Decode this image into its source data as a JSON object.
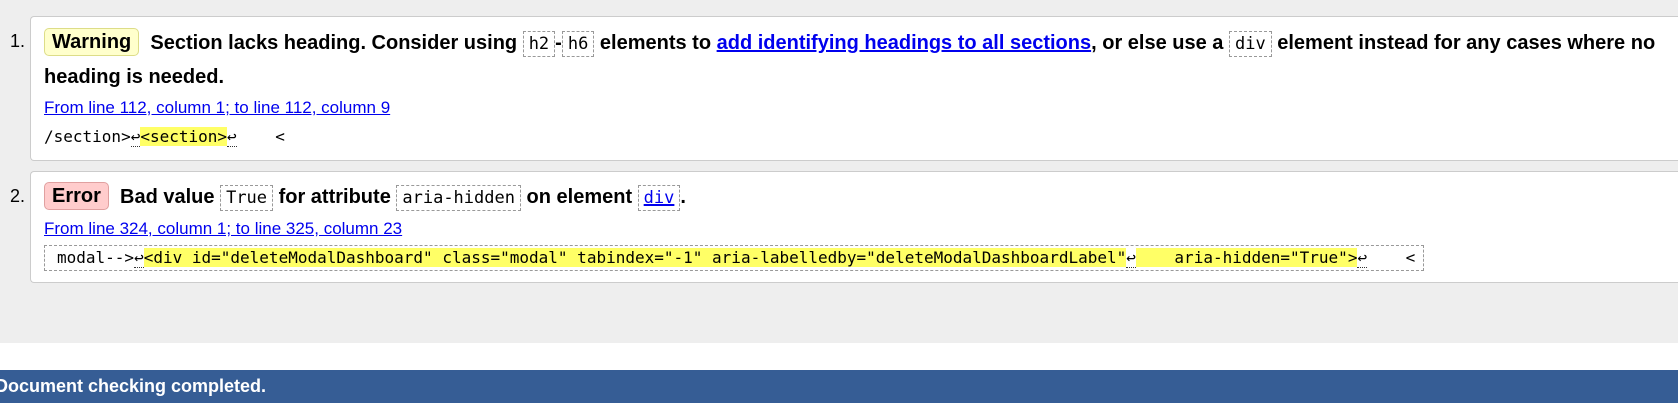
{
  "messages": [
    {
      "number": "1.",
      "type": "Warning",
      "text_1": "Section lacks heading. Consider using",
      "code_1": "h2",
      "dash": "-",
      "code_2": "h6",
      "text_2": "elements to",
      "link": "add identifying headings to all sections",
      "text_3": ", or else use a",
      "code_3": "div",
      "text_4": "element instead for any cases where no",
      "text_5": "heading is needed.",
      "location": "From line 112, column 1; to line 112, column 9",
      "extract": {
        "before": "/section>",
        "return_1": "↩",
        "highlight": "<section>",
        "return_2": "↩",
        "after": "    <"
      }
    },
    {
      "number": "2.",
      "type": "Error",
      "text_1": "Bad value",
      "code_1": "True",
      "text_2": "for attribute",
      "code_2": "aria-hidden",
      "text_3": "on element",
      "code_3": "div",
      "text_4": ".",
      "location": "From line 324, column 1; to line 325, column 23",
      "extract": {
        "before": "modal-->",
        "return_1": "↩",
        "highlight_1": "<div id=\"deleteModalDashboard\" class=\"modal\" tabindex=\"-1\" aria-labelledby=\"deleteModalDashboardLabel\"",
        "return_2": "↩",
        "highlight_2": "    aria-hidden=\"True\">",
        "return_3": "↩",
        "after": "    <"
      }
    }
  ],
  "status": "Document checking completed.",
  "colors": {
    "warning_badge": "#ffffcc",
    "error_badge": "#ffcccc",
    "highlight": "#ffff66",
    "status_bar": "#365d95",
    "link": "#0000ee"
  }
}
